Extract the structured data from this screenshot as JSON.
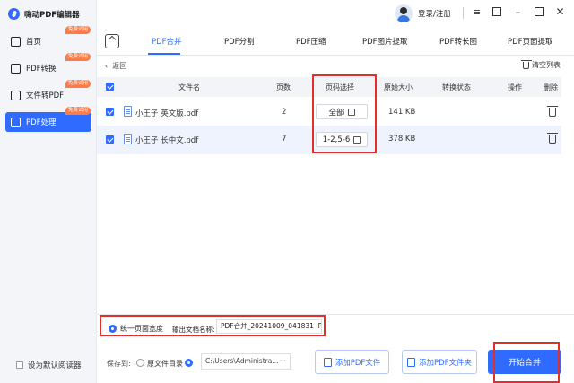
{
  "app": {
    "title": "嗨动PDF编辑器"
  },
  "sidebar": {
    "items": [
      {
        "label": "首页",
        "badge": "免费试用",
        "icon": "home-icon"
      },
      {
        "label": "PDF转换",
        "badge": "免费试用",
        "icon": "convert-icon"
      },
      {
        "label": "文件转PDF",
        "badge": "免费试用",
        "icon": "file-to-pdf-icon"
      },
      {
        "label": "PDF处理",
        "badge": "免费试用",
        "icon": "pdf-process-icon",
        "active": true
      }
    ],
    "default_reader": "设为默认阅读器"
  },
  "header": {
    "login": "登录/注册"
  },
  "tabs": [
    "PDF合并",
    "PDF分割",
    "PDF压缩",
    "PDF图片提取",
    "PDF转长图",
    "PDF页面提取"
  ],
  "toolbar": {
    "back": "返回",
    "clear": "清空列表"
  },
  "table": {
    "headers": [
      "文件名",
      "页数",
      "页码选择",
      "原始大小",
      "转换状态",
      "操作",
      "删除"
    ],
    "rows": [
      {
        "name": "小王子 英文版.pdf",
        "pages": "2",
        "page_select": "全部",
        "size": "141 KB"
      },
      {
        "name": "小王子 长中文.pdf",
        "pages": "7",
        "page_select": "1-2,5-6",
        "size": "378 KB"
      }
    ]
  },
  "bottom": {
    "unify_width": "统一页面宽度",
    "output_label": "输出文档名称:",
    "output_name": "PDF合并_20241009_041831 .PDF",
    "save_to": "保存到:",
    "orig_dir": "原文件目录",
    "path": "C:\\Users\\Administra...",
    "path_more": "···",
    "add_file": "添加PDF文件",
    "add_folder": "添加PDF文件夹",
    "start": "开始合并"
  },
  "colors": {
    "accent": "#2f6bff",
    "highlight": "#e0302c",
    "badge": "#ff7a45"
  }
}
